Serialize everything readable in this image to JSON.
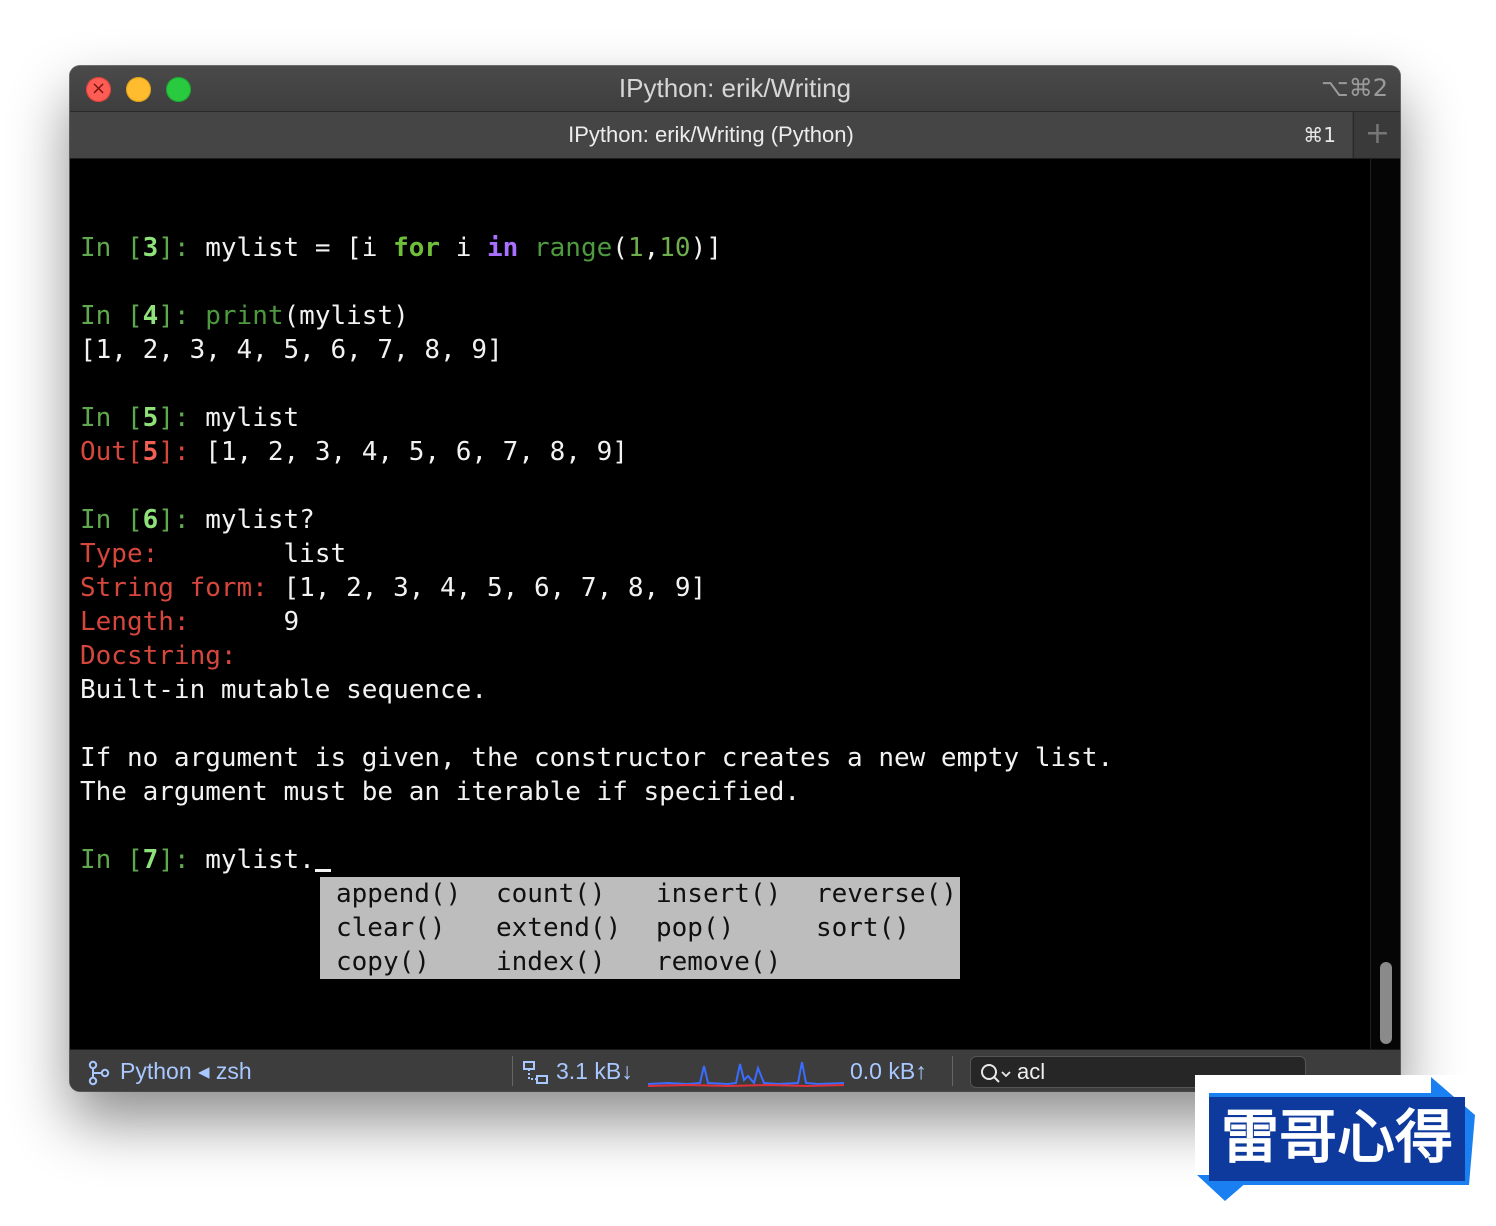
{
  "window": {
    "title": "IPython: erik/Writing",
    "title_shortcut": "⌥⌘2"
  },
  "tab": {
    "title": "IPython: erik/Writing (Python)",
    "shortcut": "⌘1",
    "add_label": "+"
  },
  "terminal": {
    "lines": [
      {
        "in": "In [",
        "n": "3",
        "close": "]: ",
        "code": "mylist = [i for i in range(1,10)]"
      },
      {
        "in": "In [",
        "n": "4",
        "close": "]: ",
        "fn": "print",
        "code": "(mylist)"
      },
      {
        "text": "[1, 2, 3, 4, 5, 6, 7, 8, 9]"
      },
      {
        "in": "In [",
        "n": "5",
        "close": "]: ",
        "code": "mylist"
      },
      {
        "out": "Out[",
        "n": "5",
        "close": "]: ",
        "code": "[1, 2, 3, 4, 5, 6, 7, 8, 9]"
      },
      {
        "in": "In [",
        "n": "6",
        "close": "]: ",
        "code": "mylist?"
      },
      {
        "label": "Type:",
        "pad": "        ",
        "value": "list"
      },
      {
        "label": "String form:",
        "pad": " ",
        "value": "[1, 2, 3, 4, 5, 6, 7, 8, 9]"
      },
      {
        "label": "Length:",
        "pad": "      ",
        "value": "9"
      },
      {
        "label": "Docstring:",
        "pad": "",
        "value": ""
      },
      {
        "text": "Built-in mutable sequence."
      },
      {
        "text": "If no argument is given, the constructor creates a new empty list."
      },
      {
        "text": "The argument must be an iterable if specified."
      },
      {
        "in": "In [",
        "n": "7",
        "close": "]: ",
        "code": "mylist."
      }
    ],
    "code3": {
      "a": "mylist = [i ",
      "for": "for",
      "b": " i ",
      "in": "in",
      "c": " ",
      "range": "range",
      "d": "(",
      "n1": "1",
      "e": ",",
      "n2": "10",
      "f": ")]"
    }
  },
  "completion": {
    "items": [
      "append()",
      "count()",
      "insert()",
      "reverse()",
      "clear()",
      "extend()",
      "pop()",
      "sort()",
      "copy()",
      "index()",
      "remove()"
    ]
  },
  "statusbar": {
    "session": "Python ◂ zsh",
    "net_down": "3.1 kB↓",
    "net_up": "0.0 kB↑",
    "search_value": "acl"
  },
  "colors": {
    "prompt_in": "#5fa84d",
    "prompt_out": "#d5463c",
    "keyword_purple": "#a970ff",
    "status_text": "#a9c8ff",
    "watermark_blue": "#0d3a9c"
  },
  "watermark": {
    "text": "雷哥心得"
  }
}
